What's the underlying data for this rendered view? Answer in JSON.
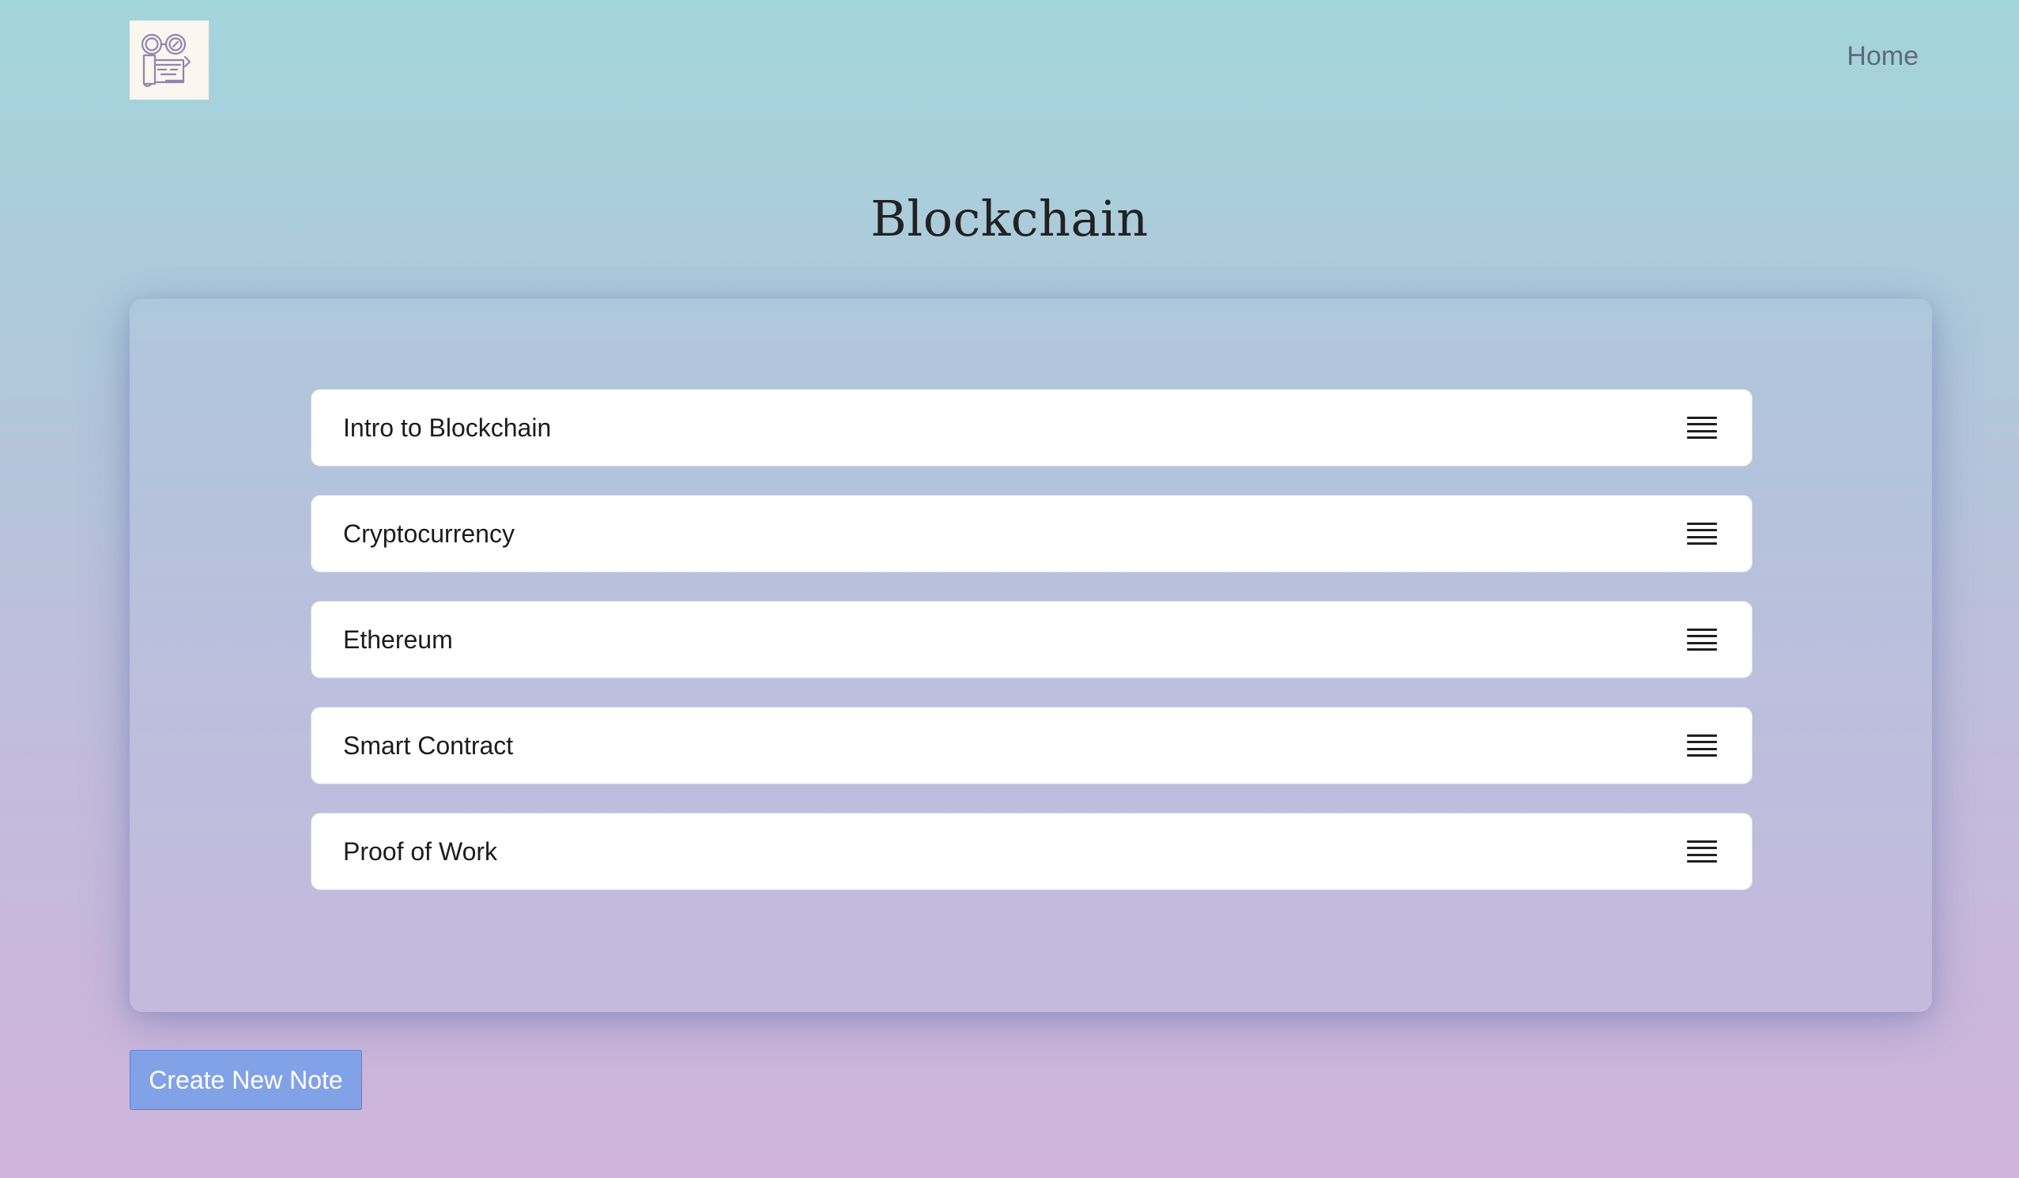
{
  "header": {
    "logo_icon": "books-magnifier-logo-icon",
    "nav_home_label": "Home"
  },
  "main": {
    "title": "Blockchain",
    "notes": [
      {
        "title": "Intro to Blockchain",
        "icon": "hamburger-menu-icon"
      },
      {
        "title": "Cryptocurrency",
        "icon": "hamburger-menu-icon"
      },
      {
        "title": "Ethereum",
        "icon": "hamburger-menu-icon"
      },
      {
        "title": "Smart Contract",
        "icon": "hamburger-menu-icon"
      },
      {
        "title": "Proof of Work",
        "icon": "hamburger-menu-icon"
      }
    ]
  },
  "actions": {
    "create_label": "Create New Note"
  },
  "colors": {
    "gradient_top": "#a3d5dc",
    "gradient_bottom": "#d0b4db",
    "button_bg": "#82a2e8",
    "logo_stroke": "#8e86ad"
  }
}
